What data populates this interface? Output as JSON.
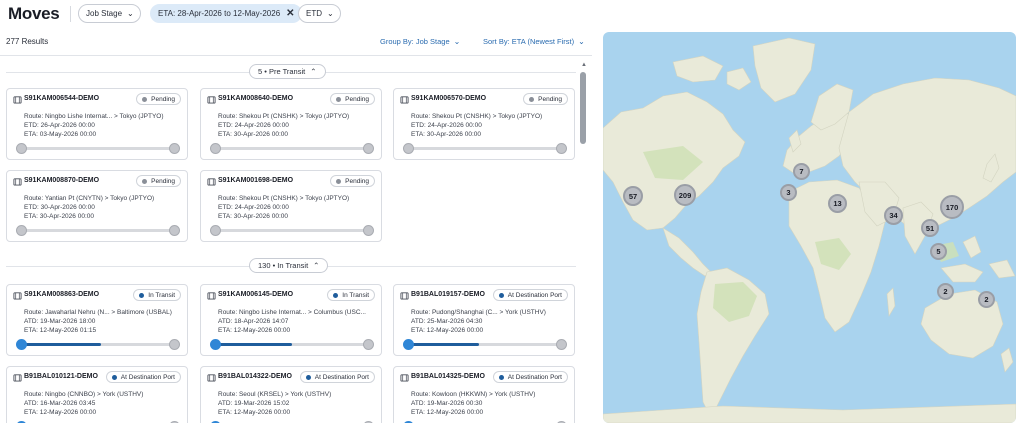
{
  "app": {
    "title": "Moves"
  },
  "filters": {
    "job_stage": "Job Stage",
    "eta_range": "ETA: 28-Apr-2026 to 12-May-2026",
    "etd": "ETD"
  },
  "results": {
    "count_label": "277 Results"
  },
  "controls": {
    "group_by": "Group By: Job Stage",
    "sort_by": "Sort By: ETA (Newest First)"
  },
  "groups": [
    {
      "label": "5 • Pre Transit",
      "cards": [
        {
          "ref": "S91KAM006544-DEMO",
          "status": "Pending",
          "status_color": "#8a8f98",
          "route": "Route: Ningbo Lishe Internat... > Tokyo (JPTYO)",
          "line2": "ETD: 26-Apr-2026 00:00",
          "line3": "ETA: 03-May-2026 00:00",
          "progress": 0
        },
        {
          "ref": "S91KAM008640-DEMO",
          "status": "Pending",
          "status_color": "#8a8f98",
          "route": "Route: Shekou Pt (CNSHK) > Tokyo (JPTYO)",
          "line2": "ETD: 24-Apr-2026 00:00",
          "line3": "ETA: 30-Apr-2026 00:00",
          "progress": 0
        },
        {
          "ref": "S91KAM006570-DEMO",
          "status": "Pending",
          "status_color": "#8a8f98",
          "route": "Route: Shekou Pt (CNSHK) > Tokyo (JPTYO)",
          "line2": "ETD: 24-Apr-2026 00:00",
          "line3": "ETA: 30-Apr-2026 00:00",
          "progress": 0
        },
        {
          "ref": "S91KAM008870-DEMO",
          "status": "Pending",
          "status_color": "#8a8f98",
          "route": "Route: Yantian Pt (CNYTN) > Tokyo (JPTYO)",
          "line2": "ETD: 30-Apr-2026 00:00",
          "line3": "ETA: 30-Apr-2026 00:00",
          "progress": 0
        },
        {
          "ref": "S91KAM001698-DEMO",
          "status": "Pending",
          "status_color": "#8a8f98",
          "route": "Route: Shekou Pt (CNSHK) > Tokyo (JPTYO)",
          "line2": "ETD: 24-Apr-2026 00:00",
          "line3": "ETA: 30-Apr-2026 00:00",
          "progress": 0
        }
      ]
    },
    {
      "label": "130 • In Transit",
      "cards": [
        {
          "ref": "S91KAM008863-DEMO",
          "status": "In Transit",
          "status_color": "#1f5d9c",
          "route": "Route: Jawaharlal Nehru (N... > Baltimore (USBAL)",
          "line2": "ATD: 19-Mar-2026 18:00",
          "line3": "ETA: 12-May-2026 01:15",
          "progress": 0.52
        },
        {
          "ref": "S91KAM006145-DEMO",
          "status": "In Transit",
          "status_color": "#1f5d9c",
          "route": "Route: Ningbo Lishe Internat... > Columbus (USC...",
          "line2": "ATD: 18-Apr-2026 14:07",
          "line3": "ETA: 12-May-2026 00:00",
          "progress": 0.5
        },
        {
          "ref": "B91BAL019157-DEMO",
          "status": "At Destination Port",
          "status_color": "#1f5d9c",
          "route": "Route: Pudong/Shanghai (C... > York (USTHV)",
          "line2": "ATD: 25-Mar-2026 04:30",
          "line3": "ETA: 12-May-2026 00:00",
          "progress": 0.46
        },
        {
          "ref": "B91BAL010121-DEMO",
          "status": "At Destination Port",
          "status_color": "#1f5d9c",
          "route": "Route: Ningbo (CNNBO) > York (USTHV)",
          "line2": "ATD: 16-Mar-2026 03:45",
          "line3": "ETA: 12-May-2026 00:00",
          "progress": 0.46
        },
        {
          "ref": "B91BAL014322-DEMO",
          "status": "At Destination Port",
          "status_color": "#1f5d9c",
          "route": "Route: Seoul (KRSEL) > York (USTHV)",
          "line2": "ATD: 19-Mar-2026 15:02",
          "line3": "ETA: 12-May-2026 00:00",
          "progress": 0.46
        },
        {
          "ref": "B91BAL014325-DEMO",
          "status": "At Destination Port",
          "status_color": "#1f5d9c",
          "route": "Route: Kowloon (HKKWN) > York (USTHV)",
          "line2": "ATD: 19-Mar-2026 00:30",
          "line3": "ETA: 12-May-2026 00:00",
          "progress": 0.46
        }
      ]
    }
  ],
  "map": {
    "clusters": [
      "57",
      "209",
      "7",
      "3",
      "13",
      "34",
      "170",
      "51",
      "5",
      "2",
      "2"
    ]
  }
}
